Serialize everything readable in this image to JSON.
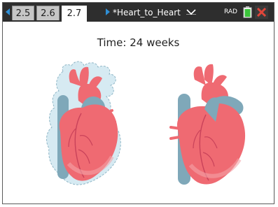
{
  "app": {
    "tabs": [
      {
        "label": "2.5"
      },
      {
        "label": "2.6"
      },
      {
        "label": "2.7",
        "active": true
      }
    ],
    "document_title": "*Heart_to_Heart",
    "mode": "RAD"
  },
  "content": {
    "time_label": "Time: 24 weeks"
  },
  "colors": {
    "toolbar_bg": "#2e2e2e",
    "nav_arrow": "#2f8fd6",
    "close_red": "#e0463a",
    "battery_green": "#3cc43c",
    "heart_red": "#ef6a72",
    "vessel_blue": "#7fa8b9",
    "halo_blue": "#d6eaf2"
  }
}
